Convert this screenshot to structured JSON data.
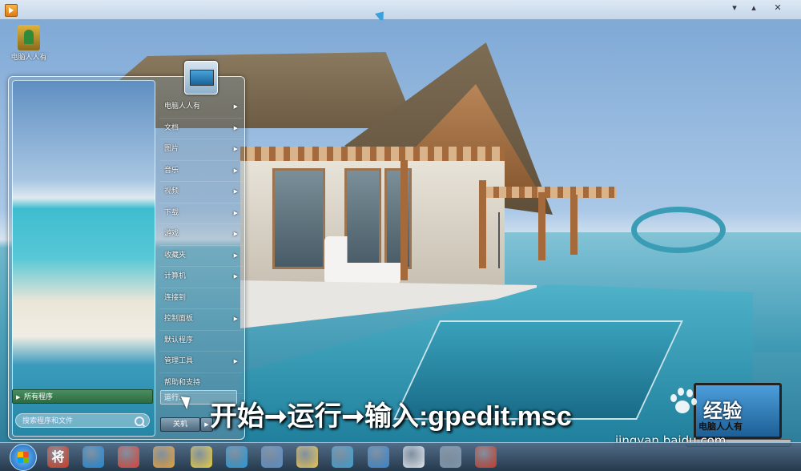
{
  "desktop": {
    "icon_label": "电脑人人有"
  },
  "start_menu": {
    "right_items": [
      {
        "label": "电脑人人有",
        "has_arrow": true
      },
      {
        "label": "文档",
        "has_arrow": true
      },
      {
        "label": "图片",
        "has_arrow": true
      },
      {
        "label": "音乐",
        "has_arrow": true
      },
      {
        "label": "视频",
        "has_arrow": true
      },
      {
        "label": "下载",
        "has_arrow": true
      },
      {
        "label": "游戏",
        "has_arrow": true
      },
      {
        "label": "收藏夹",
        "has_arrow": true
      },
      {
        "label": "计算机",
        "has_arrow": true
      },
      {
        "label": "连接到",
        "has_arrow": false
      },
      {
        "label": "控制面板",
        "has_arrow": true
      },
      {
        "label": "默认程序",
        "has_arrow": false
      },
      {
        "label": "管理工具",
        "has_arrow": true
      },
      {
        "label": "帮助和支持",
        "has_arrow": false
      }
    ],
    "run_label": "运行...",
    "all_programs_label": "所有程序",
    "search_placeholder": "搜索程序和文件",
    "shutdown_label": "关机",
    "shutdown_arrow": "▶"
  },
  "caption": "开始➞运行➞输入:gpedit.msc",
  "watermark": {
    "brand": "经验",
    "url": "jingyan.baidu.com",
    "laptop_text": "电脑人人有"
  },
  "window_controls": {
    "minimize": "▾",
    "maximize": "▴",
    "close": "✕"
  },
  "taskbar": {
    "items": [
      {
        "name": "start-orb-icon",
        "color": "#1a5fb0"
      },
      {
        "name": "jiang-app-icon",
        "label": "将",
        "color": "#d63a1e"
      },
      {
        "name": "internet-explorer-icon",
        "color": "#1f8ad8"
      },
      {
        "name": "chrome-icon",
        "color": "#db4437"
      },
      {
        "name": "media-player-icon",
        "color": "#e8a33b"
      },
      {
        "name": "note-folder-icon",
        "color": "#e9cf4a"
      },
      {
        "name": "browser-360-icon",
        "color": "#2a9ad6"
      },
      {
        "name": "remote-desktop-icon",
        "color": "#5c8fc7"
      },
      {
        "name": "file-explorer-icon",
        "color": "#e8c55a"
      },
      {
        "name": "pinwheel-icon",
        "color": "#3fa0d0"
      },
      {
        "name": "dots-app-icon",
        "color": "#3a87cf"
      },
      {
        "name": "paint-icon",
        "color": "#e0e6ee"
      },
      {
        "name": "settings-gear-icon",
        "color": "#7f97ad"
      },
      {
        "name": "red-app-icon",
        "color": "#c53b2c"
      }
    ]
  }
}
